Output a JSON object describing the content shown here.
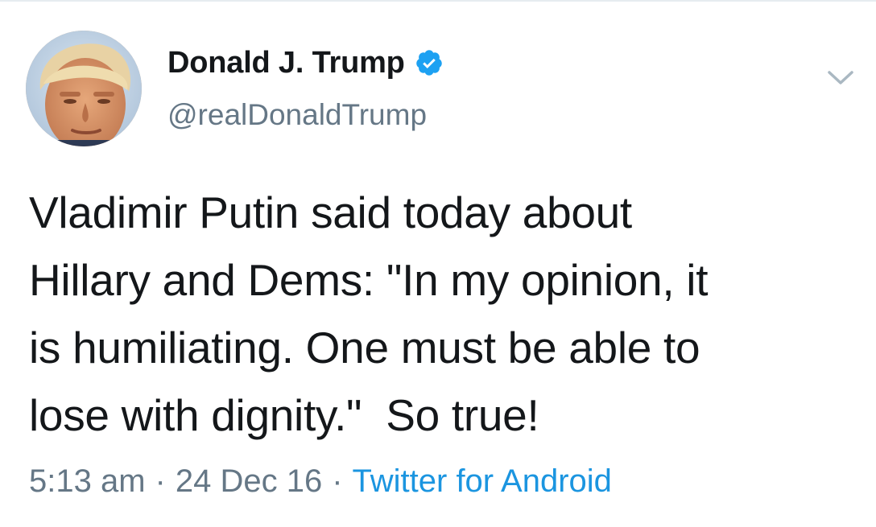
{
  "author": {
    "display_name": "Donald J. Trump",
    "handle": "@realDonaldTrump",
    "verified": true,
    "avatar_icon": "profile-photo"
  },
  "tweet": {
    "text": "Vladimir Putin said today about\nHillary and Dems: \"In my opinion, it\nis humiliating. One must be able to\nlose with dignity.\"  So true!"
  },
  "meta": {
    "time": "5:13 am",
    "separator": "·",
    "date": "24 Dec 16",
    "source": "Twitter for Android"
  },
  "colors": {
    "text_primary": "#14171a",
    "text_secondary": "#657786",
    "link": "#1b95e0",
    "verified_badge": "#1da1f2"
  },
  "icons": {
    "verified": "verified-badge-icon",
    "menu": "chevron-down-icon"
  }
}
